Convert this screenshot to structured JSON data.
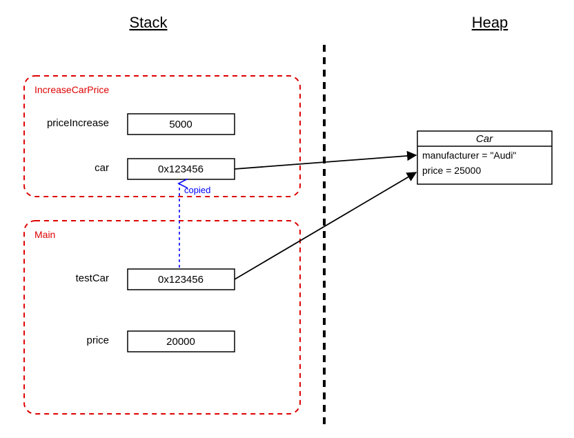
{
  "titles": {
    "stack": "Stack",
    "heap": "Heap"
  },
  "frames": [
    {
      "name": "IncreaseCarPrice",
      "vars": [
        {
          "label": "priceIncrease",
          "value": "5000",
          "pointsToHeap": false
        },
        {
          "label": "car",
          "value": "0x123456",
          "pointsToHeap": true
        }
      ]
    },
    {
      "name": "Main",
      "vars": [
        {
          "label": "testCar",
          "value": "0x123456",
          "pointsToHeap": true
        },
        {
          "label": "price",
          "value": "20000",
          "pointsToHeap": false
        }
      ]
    }
  ],
  "copiedLabel": "copied",
  "heap": {
    "className": "Car",
    "fields": [
      "manufacturer = \"Audi\"",
      "price = 25000"
    ]
  }
}
